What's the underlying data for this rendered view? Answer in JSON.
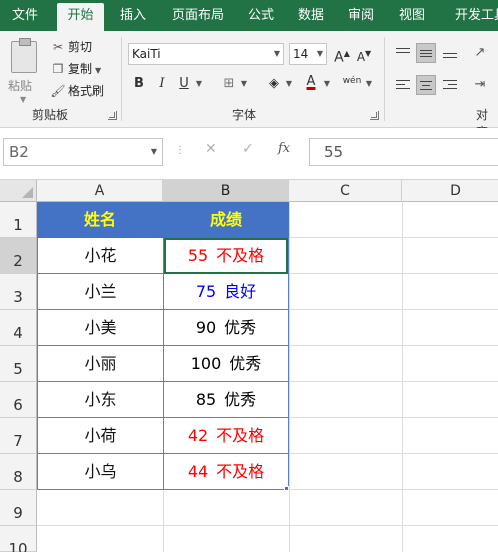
{
  "tabs": [
    {
      "label": "文件",
      "active": false
    },
    {
      "label": "开始",
      "active": true
    },
    {
      "label": "插入",
      "active": false
    },
    {
      "label": "页面布局",
      "active": false
    },
    {
      "label": "公式",
      "active": false
    },
    {
      "label": "数据",
      "active": false
    },
    {
      "label": "审阅",
      "active": false
    },
    {
      "label": "视图",
      "active": false
    },
    {
      "label": "开发工具",
      "active": false
    }
  ],
  "clipboard": {
    "paste_label": "粘贴",
    "cut_label": "剪切",
    "copy_label": "复制",
    "format_painter_label": "格式刷",
    "group_label": "剪贴板"
  },
  "font": {
    "font_name": "KaiTi",
    "font_size": "14",
    "bold": "B",
    "italic": "I",
    "underline": "U",
    "grow": "A",
    "shrink": "A",
    "font_color_glyph": "A",
    "phonetic_glyph": "wén",
    "group_label": "字体"
  },
  "alignment": {
    "group_label": "对齐"
  },
  "formula_bar": {
    "name_box": "B2",
    "fx_label": "fx",
    "cancel_glyph": "✕",
    "enter_glyph": "✓",
    "value": "55"
  },
  "columns": [
    "A",
    "B",
    "C",
    "D"
  ],
  "rows": [
    "1",
    "2",
    "3",
    "4",
    "5",
    "6",
    "7",
    "8",
    "9",
    "10"
  ],
  "table": {
    "headers": {
      "name": "姓名",
      "grade": "成绩"
    },
    "records": [
      {
        "name": "小花",
        "score": "55",
        "remark": "不及格",
        "color": "#ff0000"
      },
      {
        "name": "小兰",
        "score": "75",
        "remark": "良好",
        "color": "#0000ff"
      },
      {
        "name": "小美",
        "score": "90",
        "remark": "优秀",
        "color": "#000000"
      },
      {
        "name": "小丽",
        "score": "100",
        "remark": "优秀",
        "color": "#000000"
      },
      {
        "name": "小东",
        "score": "85",
        "remark": "优秀",
        "color": "#000000"
      },
      {
        "name": "小荷",
        "score": "42",
        "remark": "不及格",
        "color": "#ff0000"
      },
      {
        "name": "小乌",
        "score": "44",
        "remark": "不及格",
        "color": "#ff0000"
      }
    ]
  },
  "colors": {
    "accent": "#217346",
    "header_fill": "#4472c4",
    "header_text": "#ffff00"
  }
}
